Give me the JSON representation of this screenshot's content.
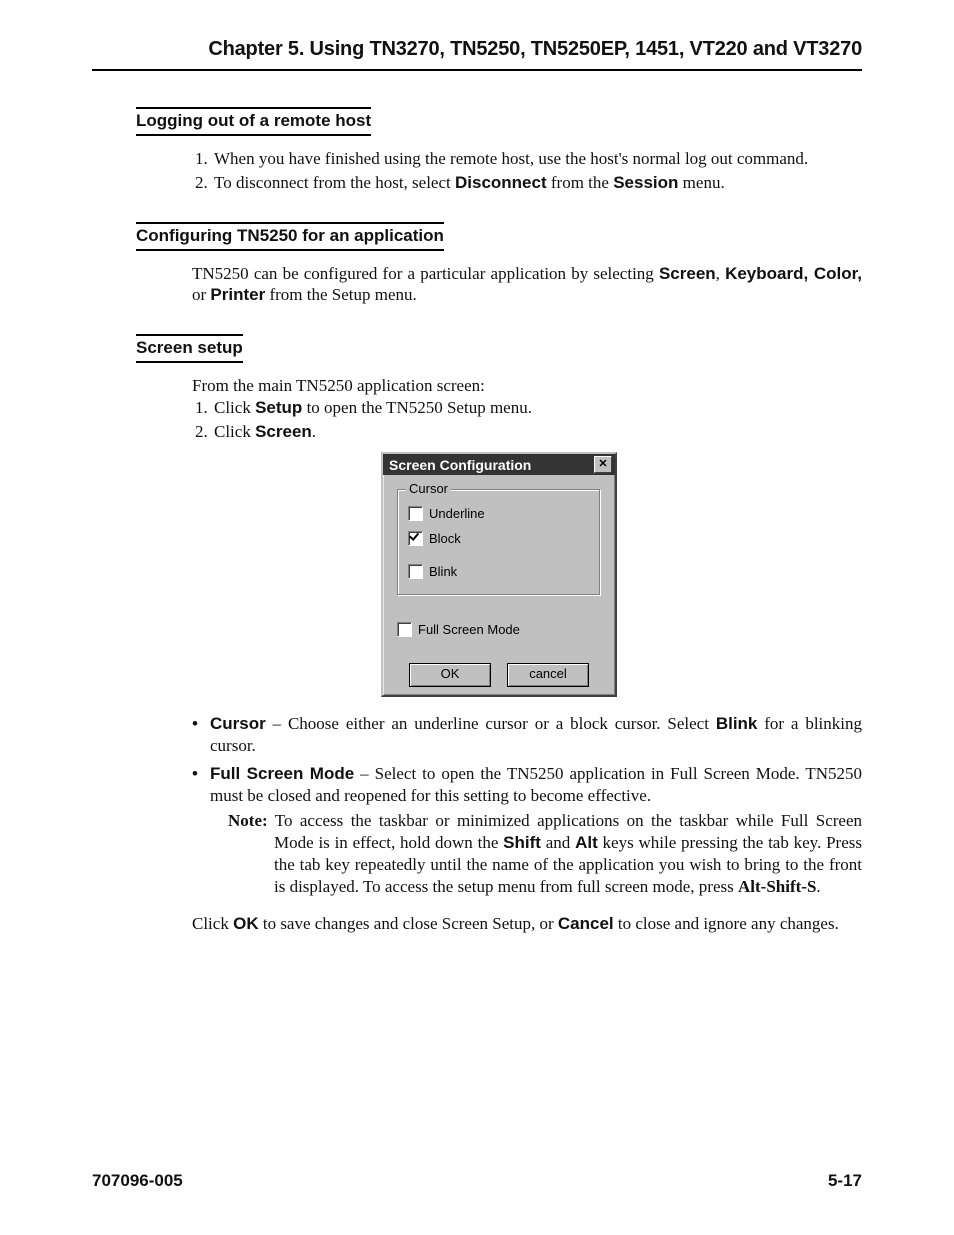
{
  "header": {
    "chapter_title": "Chapter 5.  Using  TN3270, TN5250, TN5250EP, 1451, VT220 and VT3270"
  },
  "section_logout": {
    "heading": "Logging out of a remote host",
    "items": [
      {
        "pre": "When you have finished using the remote host, use the host's normal log out command."
      },
      {
        "pre": "To disconnect from the host, select ",
        "b1": "Disconnect",
        "mid": " from the ",
        "b2": "Session",
        "post": " menu."
      }
    ]
  },
  "section_config": {
    "heading": "Configuring TN5250 for an application",
    "para_pre": "TN5250 can be configured for a particular application by selecting ",
    "b1": "Screen",
    "mid1": ", ",
    "b2": "Keyboard, Color,",
    "mid2": " or ",
    "b3": "Printer",
    "post": " from the Setup menu."
  },
  "section_screen": {
    "heading": "Screen setup",
    "intro": "From the main TN5250 application screen:",
    "items": [
      {
        "pre": "Click ",
        "b1": "Setup",
        "post": " to open the TN5250 Setup menu."
      },
      {
        "pre": "Click ",
        "b1": "Screen",
        "post": "."
      }
    ]
  },
  "dialog": {
    "title": "Screen Configuration",
    "group_title": "Cursor",
    "chk_underline": "Underline",
    "chk_block": "Block",
    "chk_blink": "Blink",
    "chk_fullscreen": "Full Screen Mode",
    "btn_ok": "OK",
    "btn_cancel": "cancel"
  },
  "bullets": {
    "cursor_b": "Cursor",
    "cursor_mid": " – Choose either an underline cursor or a block cursor. Select ",
    "cursor_b2": "Blink",
    "cursor_post": " for a blinking cursor.",
    "fsm_b": "Full Screen Mode",
    "fsm_post": " – Select to open the TN5250 application in Full Screen Mode. TN5250 must be closed and reopened for this setting to become effective.",
    "note_label": "Note:",
    "note_pre": " To access the taskbar or minimized applications on the taskbar while Full Screen Mode is in effect, hold down the ",
    "note_b1": "Shift",
    "note_mid1": " and ",
    "note_b2": "Alt",
    "note_mid2": " keys while pressing the tab key. Press the tab key repeatedly until the name of the application you wish to bring to the front is displayed. To access the setup menu from full screen mode, press ",
    "note_b3": "Alt-Shift-S",
    "note_post": "."
  },
  "closing": {
    "pre": "Click ",
    "b1": "OK",
    "mid": " to save changes and close Screen Setup, or ",
    "b2": "Cancel",
    "post": " to close and ignore any changes."
  },
  "footer": {
    "doc_number": "707096-005",
    "page_number": "5-17"
  }
}
